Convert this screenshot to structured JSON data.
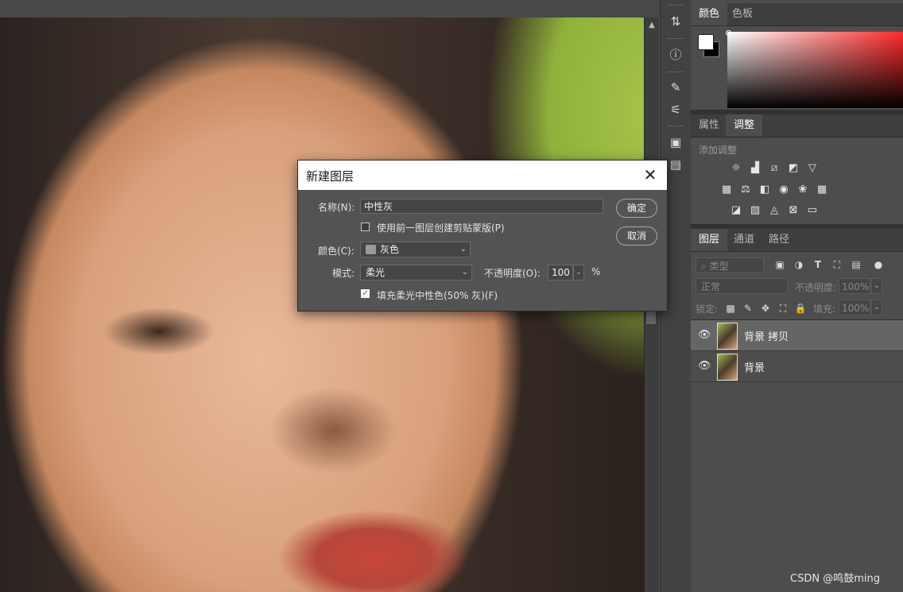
{
  "dialog": {
    "title": "新建图层",
    "name_label": "名称(N):",
    "name_value": "中性灰",
    "clip_label": "使用前一图层创建剪贴蒙版(P)",
    "clip_checked": false,
    "color_label": "颜色(C):",
    "color_value": "灰色",
    "color_swatch": "#9a9a9a",
    "mode_label": "模式:",
    "mode_value": "柔光",
    "opacity_label": "不透明度(O):",
    "opacity_value": "100",
    "opacity_unit": "%",
    "fill_label": "填充柔光中性色(50% 灰)(F)",
    "fill_checked": true,
    "ok_label": "确定",
    "cancel_label": "取消",
    "close_icon": "close-icon"
  },
  "color_panel": {
    "tabs": [
      "颜色",
      "色板"
    ],
    "active_tab": "颜色",
    "foreground": "#ffffff",
    "background": "#000000",
    "hue": "#ff2a2a"
  },
  "adjust_panel": {
    "tabs": [
      "属性",
      "调整"
    ],
    "active_tab": "调整",
    "hint": "添加调整"
  },
  "layers_panel": {
    "tabs": [
      "图层",
      "通道",
      "路径"
    ],
    "active_tab": "图层",
    "filter_label": "类型",
    "blend_mode": "正常",
    "opacity_label": "不透明度:",
    "opacity_value": "100%",
    "lock_label": "锁定:",
    "fill_label": "填充:",
    "fill_value": "100%",
    "layers": [
      {
        "name": "背景 拷贝",
        "selected": true,
        "visible": true
      },
      {
        "name": "背景",
        "selected": false,
        "visible": true
      }
    ]
  },
  "watermark": "CSDN @鸣鼓ming"
}
